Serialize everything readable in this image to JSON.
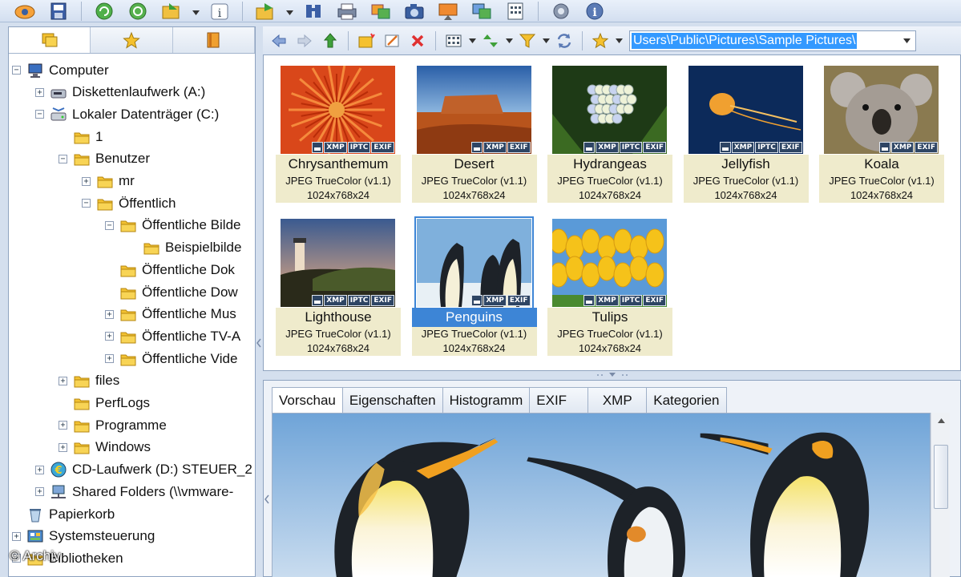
{
  "toolbar": {
    "icons": [
      "eye-icon",
      "save-icon",
      "refresh-icon",
      "history-icon",
      "import-icon",
      "info-icon",
      "export-icon",
      "find-icon",
      "print-icon",
      "convert-icon",
      "capture-icon",
      "slideshow-icon",
      "copy-icon",
      "calculator-icon",
      "settings-icon",
      "about-icon"
    ]
  },
  "left_panel": {
    "tabs": [
      "folders-tab",
      "favorites-tab",
      "catalog-tab"
    ],
    "tree": [
      {
        "label": "Computer",
        "level": 0,
        "expander": "−",
        "icon": "computer"
      },
      {
        "label": "Diskettenlaufwerk (A:)",
        "level": 1,
        "expander": "+",
        "icon": "floppy"
      },
      {
        "label": "Lokaler Datenträger (C:)",
        "level": 1,
        "expander": "−",
        "icon": "harddisk"
      },
      {
        "label": "1",
        "level": 2,
        "expander": "",
        "icon": "folder"
      },
      {
        "label": "Benutzer",
        "level": 2,
        "expander": "−",
        "icon": "folder"
      },
      {
        "label": "mr",
        "level": 3,
        "expander": "+",
        "icon": "folder"
      },
      {
        "label": "Öffentlich",
        "level": 3,
        "expander": "−",
        "icon": "folder"
      },
      {
        "label": "Öffentliche Bilde",
        "level": 4,
        "expander": "−",
        "icon": "folder"
      },
      {
        "label": "Beispielbilde",
        "level": 5,
        "expander": "",
        "icon": "folder",
        "selected": true
      },
      {
        "label": "Öffentliche Dok",
        "level": 4,
        "expander": "",
        "icon": "folder"
      },
      {
        "label": "Öffentliche Dow",
        "level": 4,
        "expander": "",
        "icon": "folder"
      },
      {
        "label": "Öffentliche Mus",
        "level": 4,
        "expander": "+",
        "icon": "folder"
      },
      {
        "label": "Öffentliche TV-A",
        "level": 4,
        "expander": "+",
        "icon": "folder"
      },
      {
        "label": "Öffentliche Vide",
        "level": 4,
        "expander": "+",
        "icon": "folder"
      },
      {
        "label": "files",
        "level": 2,
        "expander": "+",
        "icon": "folder"
      },
      {
        "label": "PerfLogs",
        "level": 2,
        "expander": "",
        "icon": "folder"
      },
      {
        "label": "Programme",
        "level": 2,
        "expander": "+",
        "icon": "folder"
      },
      {
        "label": "Windows",
        "level": 2,
        "expander": "+",
        "icon": "folder"
      },
      {
        "label": "CD-Laufwerk (D:) STEUER_2",
        "level": 1,
        "expander": "+",
        "icon": "cd"
      },
      {
        "label": "Shared Folders (\\\\vmware-",
        "level": 1,
        "expander": "+",
        "icon": "network"
      },
      {
        "label": "Papierkorb",
        "level": 0,
        "expander": "",
        "icon": "recycle"
      },
      {
        "label": "Systemsteuerung",
        "level": 0,
        "expander": "+",
        "icon": "control"
      },
      {
        "label": "Bibliotheken",
        "level": 0,
        "expander": "+",
        "icon": "folder"
      }
    ]
  },
  "nav_bar": {
    "path": "Users\\Public\\Pictures\\Sample Pictures\\"
  },
  "thumbnails": [
    {
      "name": "Chrysanthemum",
      "format": "JPEG TrueColor (v1.1)",
      "dims": "1024x768x24",
      "badges": [
        "XMP",
        "IPTC",
        "EXIF"
      ],
      "art": "chrysanthemum"
    },
    {
      "name": "Desert",
      "format": "JPEG TrueColor (v1.1)",
      "dims": "1024x768x24",
      "badges": [
        "XMP",
        "EXIF"
      ],
      "art": "desert"
    },
    {
      "name": "Hydrangeas",
      "format": "JPEG TrueColor (v1.1)",
      "dims": "1024x768x24",
      "badges": [
        "XMP",
        "IPTC",
        "EXIF"
      ],
      "art": "hydrangeas"
    },
    {
      "name": "Jellyfish",
      "format": "JPEG TrueColor (v1.1)",
      "dims": "1024x768x24",
      "badges": [
        "XMP",
        "IPTC",
        "EXIF"
      ],
      "art": "jellyfish"
    },
    {
      "name": "Koala",
      "format": "JPEG TrueColor (v1.1)",
      "dims": "1024x768x24",
      "badges": [
        "XMP",
        "EXIF"
      ],
      "art": "koala"
    },
    {
      "name": "Lighthouse",
      "format": "JPEG TrueColor (v1.1)",
      "dims": "1024x768x24",
      "badges": [
        "XMP",
        "IPTC",
        "EXIF"
      ],
      "art": "lighthouse"
    },
    {
      "name": "Penguins",
      "format": "JPEG TrueColor (v1.1)",
      "dims": "1024x768x24",
      "badges": [
        "XMP",
        "EXIF"
      ],
      "art": "penguins",
      "selected": true
    },
    {
      "name": "Tulips",
      "format": "JPEG TrueColor (v1.1)",
      "dims": "1024x768x24",
      "badges": [
        "XMP",
        "IPTC",
        "EXIF"
      ],
      "art": "tulips"
    }
  ],
  "preview": {
    "tabs": [
      "Vorschau",
      "Eigenschaften",
      "Histogramm",
      "EXIF",
      "XMP",
      "Kategorien"
    ],
    "active_tab": "Vorschau"
  },
  "watermark": "© Archiv",
  "colors": {
    "selection": "#3d85d6",
    "info_bg": "#efebcc",
    "path_highlight": "#3399ff"
  }
}
